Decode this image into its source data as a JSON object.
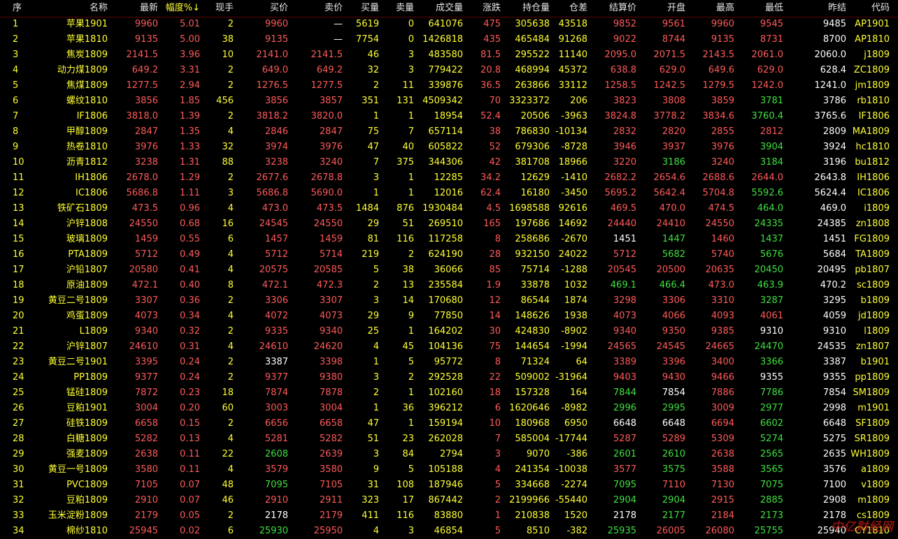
{
  "columns": [
    {
      "key": "idx",
      "label": "序"
    },
    {
      "key": "name",
      "label": "名称"
    },
    {
      "key": "last",
      "label": "最新"
    },
    {
      "key": "pct",
      "label": "幅度%↓"
    },
    {
      "key": "vol_now",
      "label": "现手"
    },
    {
      "key": "bid",
      "label": "买价"
    },
    {
      "key": "ask",
      "label": "卖价"
    },
    {
      "key": "bid_qty",
      "label": "买量"
    },
    {
      "key": "ask_qty",
      "label": "卖量"
    },
    {
      "key": "volume",
      "label": "成交量"
    },
    {
      "key": "change",
      "label": "涨跌"
    },
    {
      "key": "oi",
      "label": "持仓量"
    },
    {
      "key": "oi_diff",
      "label": "仓差"
    },
    {
      "key": "settle",
      "label": "结算价"
    },
    {
      "key": "open",
      "label": "开盘"
    },
    {
      "key": "high",
      "label": "最高"
    },
    {
      "key": "low",
      "label": "最低"
    },
    {
      "key": "prev",
      "label": "昨结"
    },
    {
      "key": "code",
      "label": "代码"
    }
  ],
  "colors": {
    "up": "#ff5a5a",
    "down": "#3fe03f",
    "flat": "#ffffff",
    "highlight": "#ffff33",
    "background": "#000000"
  },
  "rows": [
    [
      "1",
      "苹果1901",
      "9960",
      "5.01",
      "2",
      "9960",
      "—",
      "5619",
      "0",
      "641076",
      "475",
      "305638",
      "43518",
      "9852",
      "9561",
      "9960",
      "9545",
      "9485",
      "AP1901"
    ],
    [
      "2",
      "苹果1810",
      "9135",
      "5.00",
      "38",
      "9135",
      "—",
      "7754",
      "0",
      "1426818",
      "435",
      "465484",
      "91268",
      "9022",
      "8744",
      "9135",
      "8731",
      "8700",
      "AP1810"
    ],
    [
      "3",
      "焦炭1809",
      "2141.5",
      "3.96",
      "10",
      "2141.0",
      "2141.5",
      "46",
      "3",
      "483580",
      "81.5",
      "295522",
      "11140",
      "2095.0",
      "2071.5",
      "2143.5",
      "2061.0",
      "2060.0",
      "j1809"
    ],
    [
      "4",
      "动力煤1809",
      "649.2",
      "3.31",
      "2",
      "649.0",
      "649.2",
      "32",
      "3",
      "779422",
      "20.8",
      "468994",
      "45372",
      "638.8",
      "629.0",
      "649.6",
      "629.0",
      "628.4",
      "ZC1809"
    ],
    [
      "5",
      "焦煤1809",
      "1277.5",
      "2.94",
      "2",
      "1276.5",
      "1277.5",
      "2",
      "11",
      "339876",
      "36.5",
      "263866",
      "33112",
      "1258.5",
      "1242.5",
      "1279.5",
      "1242.0",
      "1241.0",
      "jm1809"
    ],
    [
      "6",
      "螺纹1810",
      "3856",
      "1.85",
      "456",
      "3856",
      "3857",
      "351",
      "131",
      "4509342",
      "70",
      "3323372",
      "206",
      "3823",
      "3808",
      "3859",
      "3781",
      "3786",
      "rb1810"
    ],
    [
      "7",
      "IF1806",
      "3818.0",
      "1.39",
      "2",
      "3818.2",
      "3820.0",
      "1",
      "1",
      "18954",
      "52.4",
      "20506",
      "-3963",
      "3824.8",
      "3778.2",
      "3834.6",
      "3760.4",
      "3765.6",
      "IF1806"
    ],
    [
      "8",
      "甲醇1809",
      "2847",
      "1.35",
      "4",
      "2846",
      "2847",
      "75",
      "7",
      "657114",
      "38",
      "786830",
      "-10134",
      "2832",
      "2820",
      "2855",
      "2812",
      "2809",
      "MA1809"
    ],
    [
      "9",
      "热卷1810",
      "3976",
      "1.33",
      "32",
      "3974",
      "3976",
      "47",
      "40",
      "605822",
      "52",
      "679306",
      "-8728",
      "3946",
      "3937",
      "3976",
      "3904",
      "3924",
      "hc1810"
    ],
    [
      "10",
      "沥青1812",
      "3238",
      "1.31",
      "88",
      "3238",
      "3240",
      "7",
      "375",
      "344306",
      "42",
      "381708",
      "18966",
      "3220",
      "3186",
      "3240",
      "3184",
      "3196",
      "bu1812"
    ],
    [
      "11",
      "IH1806",
      "2678.0",
      "1.29",
      "2",
      "2677.6",
      "2678.8",
      "3",
      "1",
      "12285",
      "34.2",
      "12629",
      "-1410",
      "2682.2",
      "2654.6",
      "2688.6",
      "2644.0",
      "2643.8",
      "IH1806"
    ],
    [
      "12",
      "IC1806",
      "5686.8",
      "1.11",
      "3",
      "5686.8",
      "5690.0",
      "1",
      "1",
      "12016",
      "62.4",
      "16180",
      "-3450",
      "5695.2",
      "5642.4",
      "5704.8",
      "5592.6",
      "5624.4",
      "IC1806"
    ],
    [
      "13",
      "铁矿石1809",
      "473.5",
      "0.96",
      "4",
      "473.0",
      "473.5",
      "1484",
      "876",
      "1930484",
      "4.5",
      "1698588",
      "92616",
      "469.5",
      "470.0",
      "474.5",
      "464.0",
      "469.0",
      "i1809"
    ],
    [
      "14",
      "沪锌1808",
      "24550",
      "0.68",
      "16",
      "24545",
      "24550",
      "29",
      "51",
      "269510",
      "165",
      "197686",
      "14692",
      "24440",
      "24410",
      "24550",
      "24335",
      "24385",
      "zn1808"
    ],
    [
      "15",
      "玻璃1809",
      "1459",
      "0.55",
      "6",
      "1457",
      "1459",
      "81",
      "116",
      "117258",
      "8",
      "258686",
      "-2670",
      "1451",
      "1447",
      "1460",
      "1437",
      "1451",
      "FG1809"
    ],
    [
      "16",
      "PTA1809",
      "5712",
      "0.49",
      "4",
      "5712",
      "5714",
      "219",
      "2",
      "624190",
      "28",
      "932150",
      "24022",
      "5712",
      "5682",
      "5740",
      "5676",
      "5684",
      "TA1809"
    ],
    [
      "17",
      "沪铅1807",
      "20580",
      "0.41",
      "4",
      "20575",
      "20585",
      "5",
      "38",
      "36066",
      "85",
      "75714",
      "-1288",
      "20545",
      "20500",
      "20635",
      "20450",
      "20495",
      "pb1807"
    ],
    [
      "18",
      "原油1809",
      "472.1",
      "0.40",
      "8",
      "472.1",
      "472.3",
      "2",
      "13",
      "235584",
      "1.9",
      "33878",
      "1032",
      "469.1",
      "466.4",
      "473.0",
      "463.9",
      "470.2",
      "sc1809"
    ],
    [
      "19",
      "黄豆二号1809",
      "3307",
      "0.36",
      "2",
      "3306",
      "3307",
      "3",
      "14",
      "170680",
      "12",
      "86544",
      "1874",
      "3298",
      "3306",
      "3310",
      "3287",
      "3295",
      "b1809"
    ],
    [
      "20",
      "鸡蛋1809",
      "4073",
      "0.34",
      "4",
      "4072",
      "4073",
      "29",
      "9",
      "77850",
      "14",
      "148626",
      "1938",
      "4073",
      "4066",
      "4093",
      "4061",
      "4059",
      "jd1809"
    ],
    [
      "21",
      "L1809",
      "9340",
      "0.32",
      "2",
      "9335",
      "9340",
      "25",
      "1",
      "164202",
      "30",
      "424830",
      "-8902",
      "9340",
      "9350",
      "9385",
      "9310",
      "9310",
      "l1809"
    ],
    [
      "22",
      "沪锌1807",
      "24610",
      "0.31",
      "4",
      "24610",
      "24620",
      "4",
      "45",
      "104136",
      "75",
      "144654",
      "-1994",
      "24565",
      "24545",
      "24665",
      "24470",
      "24535",
      "zn1807"
    ],
    [
      "23",
      "黄豆二号1901",
      "3395",
      "0.24",
      "2",
      "3387",
      "3398",
      "1",
      "5",
      "95772",
      "8",
      "71324",
      "64",
      "3389",
      "3396",
      "3400",
      "3366",
      "3387",
      "b1901"
    ],
    [
      "24",
      "PP1809",
      "9377",
      "0.24",
      "2",
      "9377",
      "9380",
      "3",
      "2",
      "292528",
      "22",
      "509002",
      "-31964",
      "9403",
      "9430",
      "9466",
      "9355",
      "9355",
      "pp1809"
    ],
    [
      "25",
      "锰硅1809",
      "7872",
      "0.23",
      "18",
      "7874",
      "7878",
      "2",
      "1",
      "102160",
      "18",
      "157328",
      "164",
      "7844",
      "7854",
      "7886",
      "7786",
      "7854",
      "SM1809"
    ],
    [
      "26",
      "豆粕1901",
      "3004",
      "0.20",
      "60",
      "3003",
      "3004",
      "1",
      "36",
      "396212",
      "6",
      "1620646",
      "-8982",
      "2996",
      "2995",
      "3009",
      "2977",
      "2998",
      "m1901"
    ],
    [
      "27",
      "硅铁1809",
      "6658",
      "0.15",
      "2",
      "6656",
      "6658",
      "47",
      "1",
      "159194",
      "10",
      "180968",
      "6950",
      "6648",
      "6648",
      "6694",
      "6602",
      "6648",
      "SF1809"
    ],
    [
      "28",
      "白糖1809",
      "5282",
      "0.13",
      "4",
      "5281",
      "5282",
      "51",
      "23",
      "262028",
      "7",
      "585004",
      "-17744",
      "5287",
      "5289",
      "5309",
      "5274",
      "5275",
      "SR1809"
    ],
    [
      "29",
      "强麦1809",
      "2638",
      "0.11",
      "22",
      "2608",
      "2639",
      "3",
      "84",
      "2794",
      "3",
      "9070",
      "-386",
      "2601",
      "2610",
      "2638",
      "2565",
      "2635",
      "WH1809"
    ],
    [
      "30",
      "黄豆一号1809",
      "3580",
      "0.11",
      "4",
      "3579",
      "3580",
      "9",
      "5",
      "105188",
      "4",
      "241354",
      "-10038",
      "3577",
      "3575",
      "3588",
      "3565",
      "3576",
      "a1809"
    ],
    [
      "31",
      "PVC1809",
      "7105",
      "0.07",
      "48",
      "7095",
      "7105",
      "31",
      "108",
      "187946",
      "5",
      "334668",
      "-2274",
      "7095",
      "7110",
      "7130",
      "7075",
      "7100",
      "v1809"
    ],
    [
      "32",
      "豆粕1809",
      "2910",
      "0.07",
      "46",
      "2910",
      "2911",
      "323",
      "17",
      "867442",
      "2",
      "2199966",
      "-55440",
      "2904",
      "2904",
      "2915",
      "2885",
      "2908",
      "m1809"
    ],
    [
      "33",
      "玉米淀粉1809",
      "2179",
      "0.05",
      "2",
      "2178",
      "2179",
      "411",
      "116",
      "83880",
      "1",
      "210838",
      "1520",
      "2178",
      "2177",
      "2184",
      "2173",
      "2178",
      "cs1809"
    ],
    [
      "34",
      "棉纱1810",
      "25945",
      "0.02",
      "6",
      "25930",
      "25950",
      "4",
      "3",
      "46854",
      "5",
      "8510",
      "-382",
      "25935",
      "26005",
      "26080",
      "25755",
      "25940",
      "CY1810"
    ]
  ],
  "watermark": "中亿财经网"
}
